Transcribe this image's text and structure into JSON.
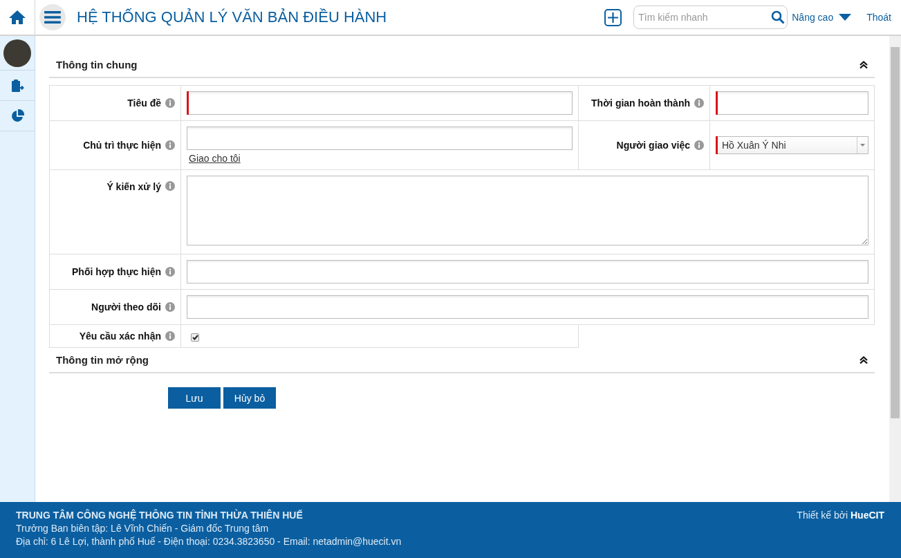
{
  "header": {
    "title": "HỆ THỐNG QUẢN LÝ VĂN BẢN ĐIỀU HÀNH",
    "search": {
      "placeholder": "Tìm kiếm nhanh"
    },
    "advanced": "Nâng cao",
    "logout": "Thoát"
  },
  "sections": [
    {
      "title": "Thông tin chung",
      "rows": [
        {
          "fields": [
            {
              "label": "Tiêu đề",
              "kind": "text",
              "required": true,
              "wide": false
            },
            {
              "label": "Thời gian hoàn thành",
              "kind": "text",
              "required": true,
              "wide": false
            }
          ]
        },
        {
          "fields": [
            {
              "label": "Chủ trì thực hiện",
              "kind": "text",
              "required": false,
              "wide": false,
              "link": "Giao cho tôi"
            },
            {
              "label": "Người giao việc",
              "kind": "select",
              "required": true,
              "wide": false,
              "value": "Hồ Xuân Ý Nhi"
            }
          ]
        },
        {
          "fields": [
            {
              "label": "Ý kiến xử lý",
              "kind": "textarea",
              "required": false,
              "wide": true
            }
          ]
        },
        {
          "fields": [
            {
              "label": "Phối hợp thực hiện",
              "kind": "text",
              "required": false,
              "wide": true
            }
          ]
        },
        {
          "fields": [
            {
              "label": "Người theo dõi",
              "kind": "text",
              "required": false,
              "wide": true
            }
          ]
        },
        {
          "fields": [
            {
              "label": "Yêu cầu xác nhận",
              "kind": "checkbox",
              "checked": true,
              "wide": false
            }
          ]
        }
      ]
    },
    {
      "title": "Thông tin mở rộng"
    }
  ],
  "buttons": [
    "Lưu",
    "Hủy bỏ"
  ],
  "footer": {
    "lines": [
      "TRUNG TÂM CÔNG NGHỆ THÔNG TIN TỈNH THỪA THIÊN HUẾ",
      "Trưởng Ban biên tập: Lê Vĩnh Chiến - Giám đốc Trung tâm",
      "Địa chỉ: 6 Lê Lợi, thành phố Huế - Điện thoại: 0234.3823650 - Email: netadmin@huecit.vn"
    ],
    "credit": "Thiết kế bởi **HueCIT**"
  }
}
